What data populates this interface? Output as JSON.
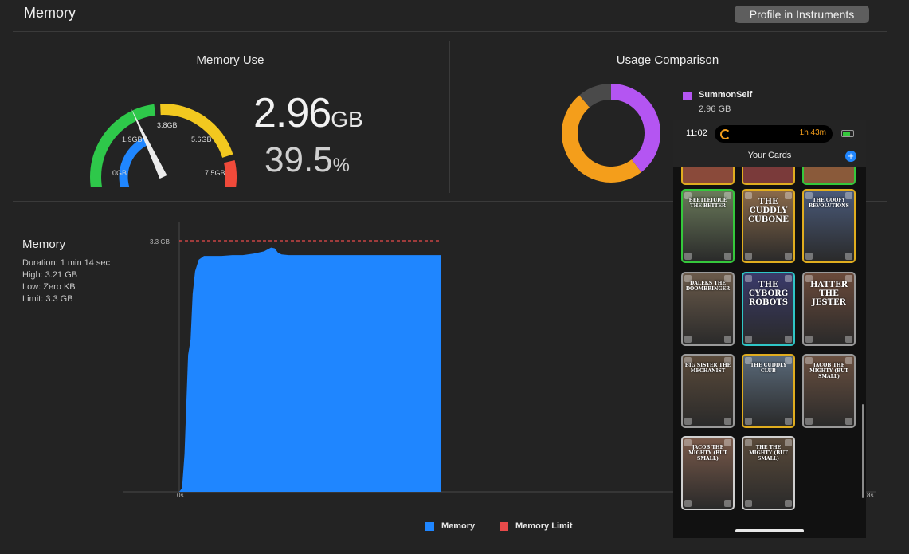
{
  "header": {
    "title": "Memory",
    "profile_button": "Profile in Instruments"
  },
  "memory_use": {
    "title": "Memory Use",
    "value": "2.96",
    "unit": "GB",
    "percent": "39.5",
    "percent_unit": "%",
    "gauge_labels": [
      "0GB",
      "1.9GB",
      "3.8GB",
      "5.6GB",
      "7.5GB"
    ],
    "gauge_fill_fraction": 0.395,
    "gauge_colors": [
      "#2ec84a",
      "#f2c81f",
      "#f04a3a"
    ],
    "fill_color": "#1f86ff"
  },
  "usage_comparison": {
    "title": "Usage Comparison",
    "legend_name": "SummonSelf",
    "legend_value": "2.96 GB",
    "colors": {
      "app": "#b455f2",
      "other": "#f49e1b",
      "free": "#4a4a4a"
    },
    "app_fraction": 0.395
  },
  "memory_chart": {
    "title": "Memory",
    "stats": [
      "Duration: 1 min 14 sec",
      "High: 3.21 GB",
      "Low: Zero KB",
      "Limit: 3.3 GB"
    ],
    "limit_label": "3.3 GB",
    "x_start_label": "0s",
    "x_end_label": "8s",
    "legend": [
      "Memory",
      "Memory Limit"
    ],
    "colors": {
      "memory": "#1f86ff",
      "limit": "#e84a4a"
    }
  },
  "chart_data": {
    "type": "area",
    "series": [
      {
        "name": "Memory",
        "x": [
          0,
          0.8,
          1.5,
          2.5,
          3.2,
          3.8,
          4.5,
          5.5,
          7,
          9,
          12,
          15,
          18,
          21,
          24,
          26,
          27,
          28,
          29,
          31,
          34,
          40,
          50,
          60,
          74
        ],
        "values": [
          0,
          0.05,
          0.5,
          1.8,
          2.0,
          2.6,
          2.9,
          3.05,
          3.1,
          3.1,
          3.1,
          3.11,
          3.11,
          3.13,
          3.16,
          3.21,
          3.2,
          3.14,
          3.12,
          3.11,
          3.11,
          3.11,
          3.11,
          3.11,
          3.11
        ]
      },
      {
        "name": "Memory Limit",
        "x": [
          0,
          74
        ],
        "values": [
          3.3,
          3.3
        ]
      }
    ],
    "xlabel": "",
    "ylabel": "",
    "ylim": [
      0,
      3.3
    ],
    "y_tick_labels": [
      "3.3 GB"
    ],
    "x_tick_labels": [
      "0s"
    ],
    "legend_position": "bottom"
  },
  "phone": {
    "time": "11:02",
    "activity": "1h 43m",
    "screen_title": "Your Cards",
    "cards": [
      {
        "title": "BEETLEJUICE THE BETTER",
        "border": "#35c83c",
        "bg": "#6a7a5a",
        "size": "small"
      },
      {
        "title": "THE CUDDLY CUBONE",
        "border": "#e0ad1f",
        "bg": "#8a6a4a",
        "size": "large"
      },
      {
        "title": "THE GOOFY REVOLUTIONS",
        "border": "#e0ad1f",
        "bg": "#4a5a7a",
        "size": "small"
      },
      {
        "title": "DALEKS THE DOOMBRINGER",
        "border": "#9a9a9a",
        "bg": "#6a5a4a",
        "size": "small"
      },
      {
        "title": "THE CYBORG ROBOTS",
        "border": "#2fc6c6",
        "bg": "#3a3a6a",
        "size": "large"
      },
      {
        "title": "HATTER THE JESTER",
        "border": "#9a9a9a",
        "bg": "#6a4a3a",
        "size": "large"
      },
      {
        "title": "BIG SISTER THE MECHANIST",
        "border": "#9a9a9a",
        "bg": "#5a4a3a",
        "size": "small"
      },
      {
        "title": "THE CUDDLY CLUB",
        "border": "#e0ad1f",
        "bg": "#5a6a7a",
        "size": "small"
      },
      {
        "title": "JACOB THE MIGHTY (BUT SMALL)",
        "border": "#9a9a9a",
        "bg": "#6a5040",
        "size": "small"
      },
      {
        "title": "JACOB THE MIGHTY (BUT SMALL)",
        "border": "#cfcfcf",
        "bg": "#7a5a4a",
        "size": "small"
      },
      {
        "title": "THE THE MIGHTY (BUT SMALL)",
        "border": "#cfcfcf",
        "bg": "#5a4a3a",
        "size": "small"
      }
    ]
  }
}
